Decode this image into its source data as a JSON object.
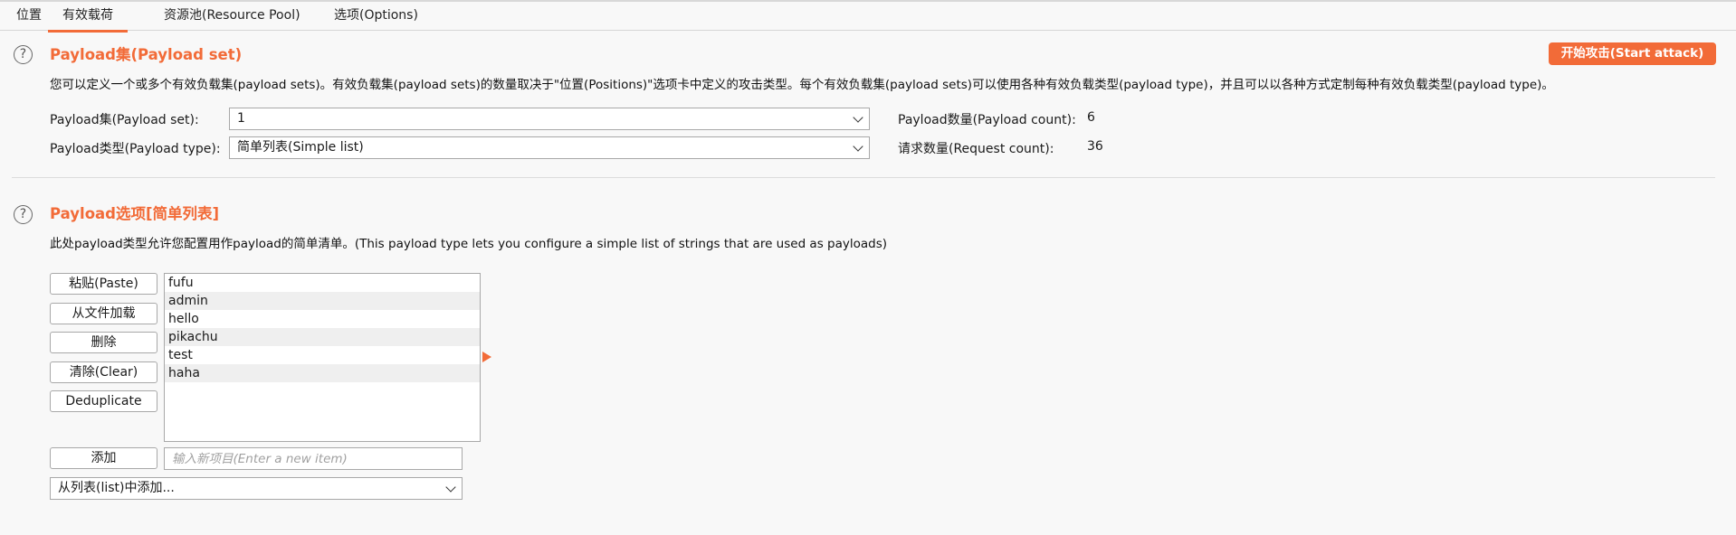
{
  "tabs": [
    "位置",
    "有效载荷",
    "资源池(Resource Pool)",
    "选项(Options)"
  ],
  "payload_set_section": {
    "title": "Payload集(Payload set)",
    "description": "您可以定义一个或多个有效负载集(payload sets)。有效负载集(payload sets)的数量取决于\"位置(Positions)\"选项卡中定义的攻击类型。每个有效负载集(payload sets)可以使用各种有效负载类型(payload type)，并且可以以各种方式定制每种有效负载类型(payload type)。",
    "start_attack_label": "开始攻击(Start attack)",
    "payload_set_label": "Payload集(Payload set):",
    "payload_set_value": "1",
    "payload_type_label": "Payload类型(Payload type):",
    "payload_type_value": "简单列表(Simple list)",
    "payload_count_label": "Payload数量(Payload count):",
    "payload_count_value": "6",
    "request_count_label": "请求数量(Request count):",
    "request_count_value": "36"
  },
  "payload_options_section": {
    "title": "Payload选项[简单列表]",
    "description": "此处payload类型允许您配置用作payload的简单清单。(This payload type lets you configure a simple list of strings that are used as payloads)",
    "buttons": {
      "paste": "粘贴(Paste)",
      "load": "从文件加载",
      "remove": "删除",
      "clear": "清除(Clear)",
      "deduplicate": "Deduplicate",
      "add": "添加"
    },
    "items": [
      "fufu",
      "admin",
      "hello",
      "pikachu",
      "test",
      "haha"
    ],
    "add_placeholder": "输入新项目(Enter a new item)",
    "add_from_list_label": "从列表(list)中添加..."
  },
  "colors": {
    "accent": "#f26b38",
    "help_icon": "#666666"
  },
  "icons": [
    "help-icon",
    "chevron-down-icon",
    "insert-arrow-icon"
  ]
}
